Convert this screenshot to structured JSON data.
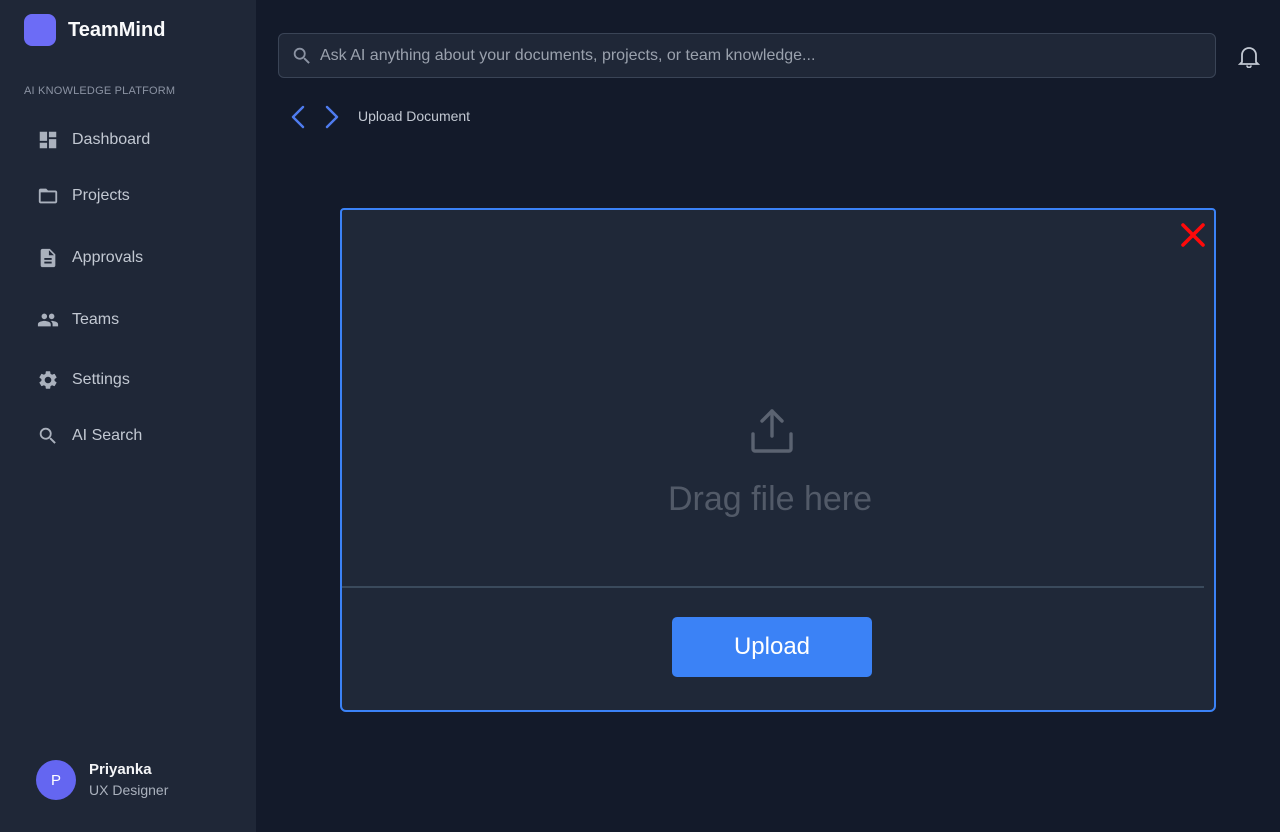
{
  "app": {
    "name": "TeamMind",
    "section_label": "AI KNOWLEDGE PLATFORM"
  },
  "sidebar": {
    "items": [
      {
        "label": "Dashboard",
        "icon": "dashboard-icon"
      },
      {
        "label": "Projects",
        "icon": "folder-icon"
      },
      {
        "label": "Approvals",
        "icon": "document-icon"
      },
      {
        "label": "Teams",
        "icon": "people-icon"
      },
      {
        "label": "Settings",
        "icon": "gear-icon"
      },
      {
        "label": "AI Search",
        "icon": "search-icon"
      }
    ]
  },
  "user": {
    "initial": "P",
    "name": "Priyanka",
    "role": "UX Designer"
  },
  "search": {
    "placeholder": "Ask AI anything about your documents, projects, or team knowledge..."
  },
  "breadcrumb": {
    "current": "Upload Document"
  },
  "modal": {
    "drop_text": "Drag file here",
    "upload_label": "Upload"
  },
  "colors": {
    "accent": "#3b82f6",
    "brand": "#6c6cf6",
    "close": "#ff0a0a",
    "sidebar_bg": "#1f2737",
    "page_bg": "#131a2a"
  }
}
